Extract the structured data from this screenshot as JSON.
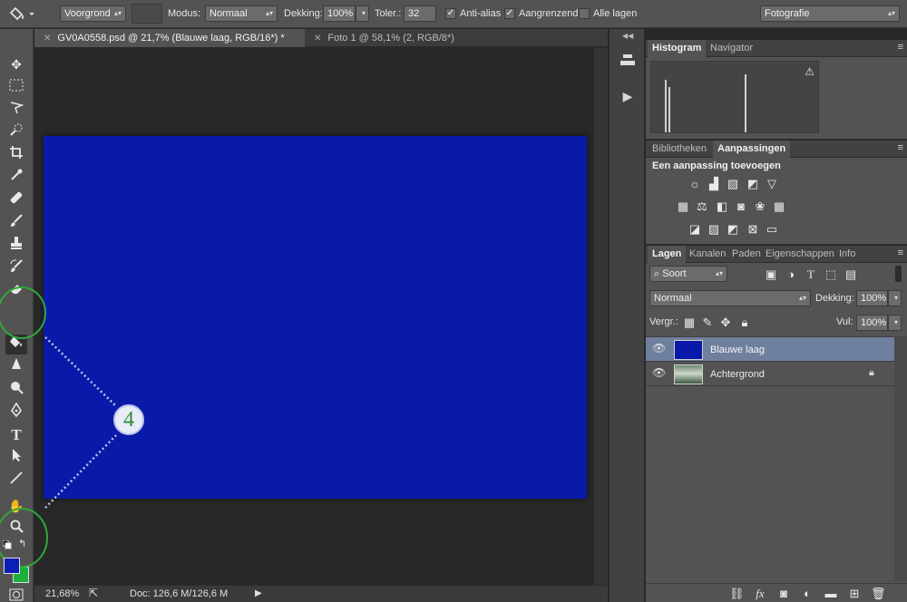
{
  "optionsbar": {
    "fill_source": "Voorgrond",
    "mode_label": "Modus:",
    "mode_value": "Normaal",
    "opacity_label": "Dekking:",
    "opacity_value": "100%",
    "tolerance_label": "Toler.:",
    "tolerance_value": "32",
    "antialias_label": "Anti-alias",
    "contiguous_label": "Aangrenzend",
    "all_layers_label": "Alle lagen",
    "workspace": "Fotografie"
  },
  "tabs": [
    {
      "label": "GV0A0558.psd @ 21,7% (Blauwe laag, RGB/16*) *",
      "active": true
    },
    {
      "label": "Foto 1 @ 58,1% (2, RGB/8*)",
      "active": false
    }
  ],
  "callout": {
    "number": "4"
  },
  "status": {
    "zoom": "21,68%",
    "doc": "Doc: 126,6 M/126,6 M"
  },
  "colors": {
    "foreground": "#0a1fb5",
    "background": "#1ab13a",
    "canvas": "#0a1aa8"
  },
  "histogram_panel": {
    "tabs": [
      "Histogram",
      "Navigator"
    ],
    "warning_icon": "warning-icon"
  },
  "adjustments_panel": {
    "tabs": [
      "Bibliotheken",
      "Aanpassingen"
    ],
    "title": "Een aanpassing toevoegen"
  },
  "layers_panel": {
    "tabs": [
      "Lagen",
      "Kanalen",
      "Paden",
      "Eigenschappen",
      "Info"
    ],
    "filter": "Soort",
    "blend_mode": "Normaal",
    "opacity_label": "Dekking:",
    "opacity_value": "100%",
    "lock_label": "Vergr.:",
    "fill_label": "Vul:",
    "fill_value": "100%",
    "layers": [
      {
        "name": "Blauwe laag",
        "selected": true
      },
      {
        "name": "Achtergrond",
        "selected": false,
        "locked": true
      }
    ]
  }
}
